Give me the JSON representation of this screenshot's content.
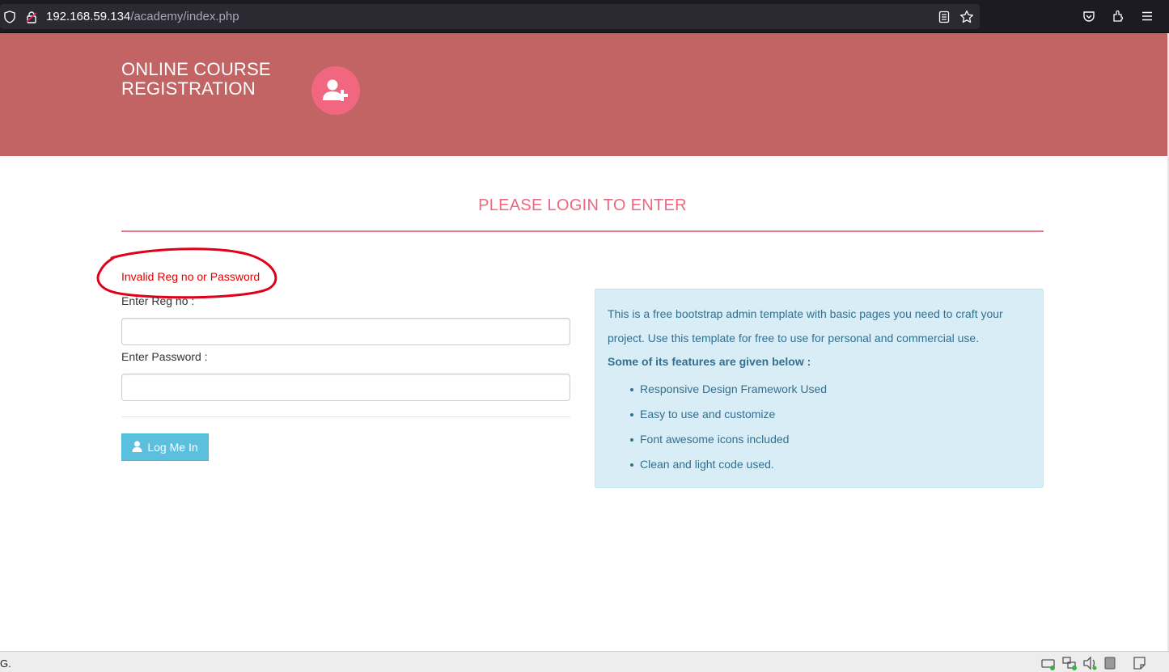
{
  "browser": {
    "url_host": "192.168.59.134",
    "url_path": "/academy/index.php"
  },
  "header": {
    "title_line1": "ONLINE COURSE",
    "title_line2": "REGISTRATION"
  },
  "login": {
    "heading": "PLEASE LOGIN TO ENTER",
    "error": "Invalid Reg no or Password",
    "reg_label": "Enter Reg no :",
    "reg_value": "",
    "password_label": "Enter Password :",
    "password_value": "",
    "button_label": "Log Me In"
  },
  "info": {
    "paragraph": "This is a free bootstrap admin template with basic pages you need to craft your project. Use this template for free to use for personal and commercial use.",
    "features_heading": "Some of its features are given below :",
    "features": [
      "Responsive Design Framework Used",
      "Easy to use and customize",
      "Font awesome icons included",
      "Clean and light code used."
    ]
  },
  "statusbar": {
    "text": "G."
  },
  "colors": {
    "header_bg": "#c26464",
    "accent": "#f0677f",
    "error": "#e60000",
    "button_bg": "#5bc0de",
    "info_bg": "#d9edf7",
    "info_text": "#31708f",
    "annotation": "#e0001a"
  },
  "icons": {
    "brand": "user-plus-icon",
    "button": "user-icon"
  }
}
